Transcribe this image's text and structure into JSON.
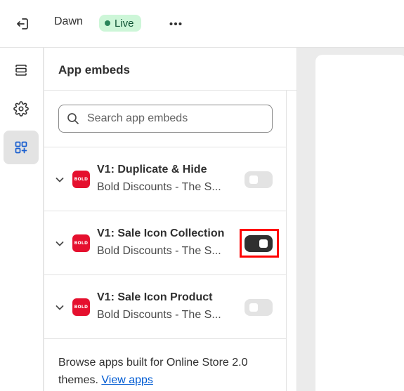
{
  "topbar": {
    "exit_icon": "exit-icon",
    "theme_name": "Dawn",
    "status_badge": "Live",
    "more_icon": "more-horizontal-icon"
  },
  "rail": {
    "items": [
      {
        "icon": "sections-icon",
        "active": false
      },
      {
        "icon": "gear-icon",
        "active": false
      },
      {
        "icon": "app-embeds-icon",
        "active": true
      }
    ]
  },
  "panel": {
    "title": "App embeds",
    "search": {
      "placeholder": "Search app embeds",
      "value": ""
    },
    "embeds": [
      {
        "name": "V1: Duplicate & Hide",
        "subtitle": "Bold Discounts - The S...",
        "logo_text": "BOLD",
        "enabled": false
      },
      {
        "name": "V1: Sale Icon Collection",
        "subtitle": "Bold Discounts - The S...",
        "logo_text": "BOLD",
        "enabled": true
      },
      {
        "name": "V1: Sale Icon Product",
        "subtitle": "Bold Discounts - The S...",
        "logo_text": "BOLD",
        "enabled": false
      }
    ],
    "browse_text": "Browse apps built for Online Store 2.0 themes.",
    "browse_link": "View apps"
  },
  "colors": {
    "accent_red": "#e5102e",
    "live_bg": "#cdf6d8",
    "live_text": "#0c5132",
    "link": "#005bd3",
    "toggle_on": "#303030",
    "highlight": "#ff0000"
  }
}
